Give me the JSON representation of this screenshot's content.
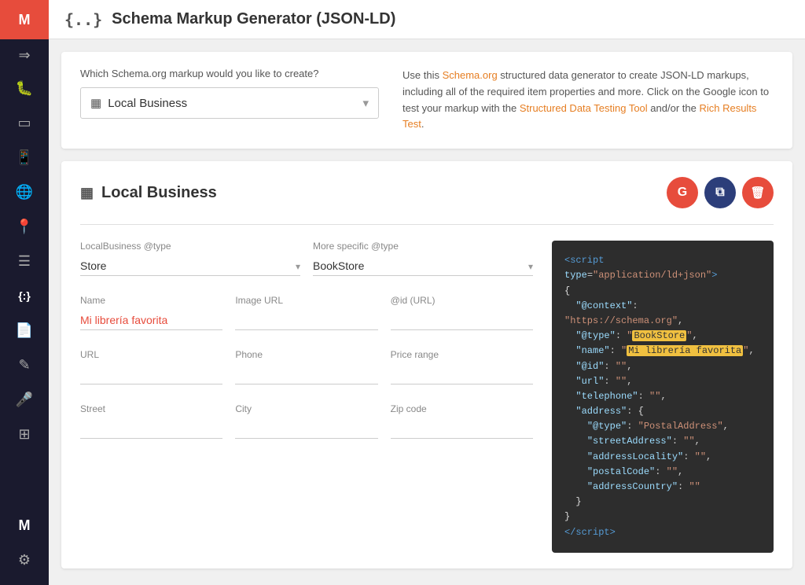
{
  "sidebar": {
    "logo_text": "M",
    "arrow_icon": "⇒",
    "icons": [
      {
        "name": "bug-icon",
        "symbol": "🐛"
      },
      {
        "name": "monitor-icon",
        "symbol": "🖥"
      },
      {
        "name": "mobile-icon",
        "symbol": "📱"
      },
      {
        "name": "globe-icon",
        "symbol": "🌐"
      },
      {
        "name": "pin-icon",
        "symbol": "📍"
      },
      {
        "name": "list-icon",
        "symbol": "☰"
      },
      {
        "name": "code-icon",
        "symbol": "{.}"
      },
      {
        "name": "document-icon",
        "symbol": "📄"
      },
      {
        "name": "edit-icon",
        "symbol": "✎"
      },
      {
        "name": "mic-icon",
        "symbol": "🎤"
      },
      {
        "name": "grid-icon",
        "symbol": "⊞"
      }
    ],
    "bottom_icons": [
      {
        "name": "m-bottom-icon",
        "symbol": "M"
      },
      {
        "name": "settings-icon",
        "symbol": "⚙"
      }
    ]
  },
  "topbar": {
    "icon": "{..}",
    "title": "Schema Markup Generator (JSON-LD)"
  },
  "selector_card": {
    "label": "Which Schema.org markup would you like to create?",
    "selected_value": "Local Business",
    "selected_icon": "▦",
    "info_text_before": "Use this ",
    "info_link1": "Schema.org",
    "info_text_mid1": " structured data generator to create JSON-LD markups, including all of the required item properties and more. Click on the Google icon to test your markup with the ",
    "info_link2": "Structured Data Testing Tool",
    "info_text_mid2": " and/or the ",
    "info_link3": "Rich Results Test",
    "info_text_after": "."
  },
  "form_card": {
    "title": "Local Business",
    "title_icon": "▦",
    "action_buttons": {
      "google_label": "G",
      "copy_label": "⧉",
      "delete_label": "🗑"
    },
    "fields": {
      "type_label": "LocalBusiness @type",
      "type_value": "Store",
      "specific_type_label": "More specific @type",
      "specific_type_value": "BookStore",
      "name_label": "Name",
      "name_value": "Mi librería favorita",
      "image_label": "Image URL",
      "image_value": "",
      "id_label": "@id (URL)",
      "id_value": "",
      "url_label": "URL",
      "url_value": "",
      "phone_label": "Phone",
      "phone_value": "",
      "price_range_label": "Price range",
      "price_range_value": "",
      "street_label": "Street",
      "street_value": "",
      "city_label": "City",
      "city_value": "",
      "zip_label": "Zip code",
      "zip_value": ""
    },
    "code": {
      "line1": "<script type=\"application/ld+json\">",
      "line2": "{",
      "line3": "  \"@context\": \"https://schema.org\",",
      "line4_pre": "  \"@type\": \"",
      "line4_hl": "BookStore",
      "line4_post": "\",",
      "line5_pre": "  \"name\": \"",
      "line5_hl": "Mi librería favorita",
      "line5_post": "\",",
      "line6": "  \"@id\": \"\",",
      "line7": "  \"url\": \"\",",
      "line8": "  \"telephone\": \"\",",
      "line9": "  \"address\": {",
      "line10": "    \"@type\": \"PostalAddress\",",
      "line11": "    \"streetAddress\": \"\",",
      "line12": "    \"addressLocality\": \"\",",
      "line13": "    \"postalCode\": \"\",",
      "line14": "    \"addressCountry\": \"\"",
      "line15": "  }",
      "line16": "}",
      "line17": "</script>"
    }
  }
}
